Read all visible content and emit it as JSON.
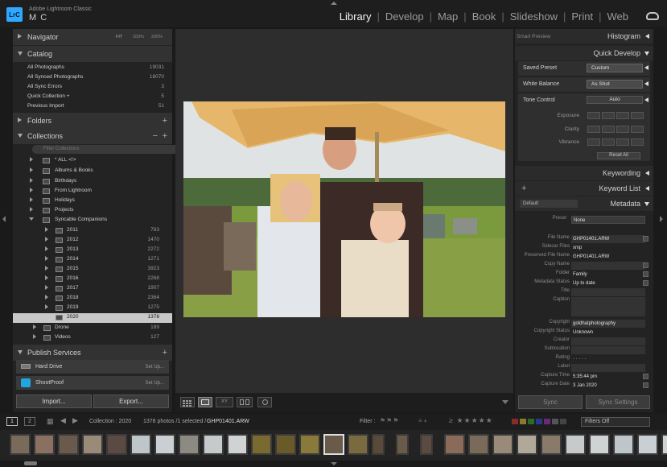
{
  "app": {
    "badge": "LrC",
    "name": "Adobe Lightroom Classic",
    "user": "M C"
  },
  "modules": [
    {
      "label": "Library",
      "active": true
    },
    {
      "label": "Develop",
      "active": false
    },
    {
      "label": "Map",
      "active": false
    },
    {
      "label": "Book",
      "active": false
    },
    {
      "label": "Slideshow",
      "active": false
    },
    {
      "label": "Print",
      "active": false
    },
    {
      "label": "Web",
      "active": false
    }
  ],
  "left": {
    "navigator": {
      "title": "Navigator",
      "zooms": [
        "FIT",
        "100%",
        "200%"
      ]
    },
    "catalog": {
      "title": "Catalog",
      "items": [
        {
          "label": "All Photographs",
          "count": "19031"
        },
        {
          "label": "All Synced Photographs",
          "count": "18070"
        },
        {
          "label": "All Sync Errors",
          "count": "3"
        },
        {
          "label": "Quick Collection +",
          "count": "5"
        },
        {
          "label": "Previous Import",
          "count": "51"
        }
      ]
    },
    "folders": {
      "title": "Folders"
    },
    "collections": {
      "title": "Collections",
      "search_placeholder": "Filter Collections",
      "items": [
        {
          "label": "* ALL <!>",
          "count": ""
        },
        {
          "label": "Albums & Books",
          "count": ""
        },
        {
          "label": "Birthdays",
          "count": ""
        },
        {
          "label": "From Lightroom",
          "count": ""
        },
        {
          "label": "Holidays",
          "count": ""
        },
        {
          "label": "Projects",
          "count": ""
        },
        {
          "label": "Syncable Companions",
          "count": ""
        },
        {
          "label": "2011",
          "count": "783"
        },
        {
          "label": "2012",
          "count": "1470"
        },
        {
          "label": "2013",
          "count": "2272"
        },
        {
          "label": "2014",
          "count": "1271"
        },
        {
          "label": "2015",
          "count": "3923"
        },
        {
          "label": "2016",
          "count": "2268"
        },
        {
          "label": "2017",
          "count": "1907"
        },
        {
          "label": "2018",
          "count": "2364"
        },
        {
          "label": "2019",
          "count": "1275"
        },
        {
          "label": "2020",
          "count": "1378"
        },
        {
          "label": "Drone",
          "count": "189"
        },
        {
          "label": "Videos",
          "count": "127"
        }
      ]
    },
    "publish": {
      "title": "Publish Services",
      "items": [
        {
          "label": "Hard Drive",
          "action": "Set Up..."
        },
        {
          "label": "ShootProof",
          "action": "Set Up..."
        }
      ]
    },
    "import_label": "Import...",
    "export_label": "Export..."
  },
  "right": {
    "histogram": {
      "title": "Histogram",
      "smart_preview": "Smart Preview"
    },
    "quick_develop": {
      "title": "Quick Develop",
      "saved_preset_label": "Saved Preset",
      "saved_preset_value": "Custom",
      "white_balance_label": "White Balance",
      "white_balance_value": "As Shot",
      "tone_control_label": "Tone Control",
      "auto_label": "Auto",
      "exposure_label": "Exposure",
      "clarity_label": "Clarity",
      "vibrance_label": "Vibrance",
      "reset_label": "Reset All"
    },
    "keywording": {
      "title": "Keywording"
    },
    "keyword_list": {
      "title": "Keyword List"
    },
    "metadata": {
      "title": "Metadata",
      "view": "Default",
      "preset_label": "Preset",
      "preset_value": "None",
      "fields": [
        {
          "key": "File Name",
          "value": "GHP01401.ARW"
        },
        {
          "key": "Sidecar Files",
          "value": "xmp"
        },
        {
          "key": "Preserved File Name",
          "value": "GHP01401.ARW"
        },
        {
          "key": "Copy Name",
          "value": ""
        },
        {
          "key": "Folder",
          "value": "Family"
        },
        {
          "key": "Metadata Status",
          "value": "Up to date"
        },
        {
          "key": "Title",
          "value": ""
        },
        {
          "key": "Caption",
          "value": ""
        },
        {
          "key": "Copyright",
          "value": "goldhatphotography"
        },
        {
          "key": "Copyright Status",
          "value": "Unknown"
        },
        {
          "key": "Creator",
          "value": ""
        },
        {
          "key": "Sublocation",
          "value": ""
        },
        {
          "key": "Rating",
          "value": "· · · · ·"
        },
        {
          "key": "Label",
          "value": ""
        },
        {
          "key": "Capture Time",
          "value": "5:35:44 pm"
        },
        {
          "key": "Capture Date",
          "value": "3 Jan 2020"
        }
      ]
    },
    "sync_label": "Sync",
    "sync_settings_label": "Sync Settings"
  },
  "filmstrip": {
    "page1": "1",
    "page2": "2",
    "source": "Collection : 2020",
    "status": "1378 photos /1 selected /",
    "filename": "GHP01401.ARW",
    "filter_label": "Filter :",
    "filters_value": "Filters Off"
  }
}
